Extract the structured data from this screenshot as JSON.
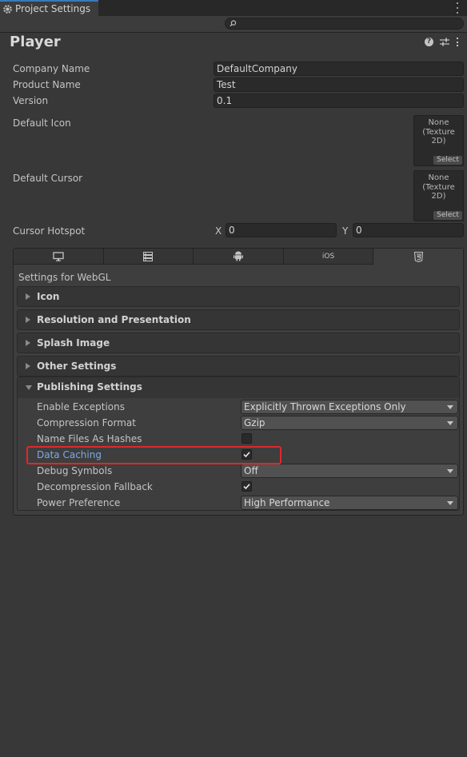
{
  "window": {
    "tab_title": "Project Settings",
    "tab_icon": "gear-icon"
  },
  "search": {
    "placeholder": ""
  },
  "header": {
    "title": "Player"
  },
  "fields": {
    "company_name": {
      "label": "Company Name",
      "value": "DefaultCompany"
    },
    "product_name": {
      "label": "Product Name",
      "value": "Test"
    },
    "version": {
      "label": "Version",
      "value": "0.1"
    },
    "default_icon": {
      "label": "Default Icon",
      "none_text": "None",
      "type_text": "(Texture 2D)",
      "select": "Select"
    },
    "default_cursor": {
      "label": "Default Cursor",
      "none_text": "None",
      "type_text": "(Texture 2D)",
      "select": "Select"
    },
    "cursor_hotspot": {
      "label": "Cursor Hotspot",
      "x_label": "X",
      "x_value": "0",
      "y_label": "Y",
      "y_value": "0"
    }
  },
  "platform_tabs": [
    {
      "icon": "monitor-icon"
    },
    {
      "icon": "server-icon"
    },
    {
      "icon": "android-icon"
    },
    {
      "label": "iOS"
    },
    {
      "icon": "html5-icon",
      "selected": true
    }
  ],
  "settings_for": "Settings for WebGL",
  "sections": [
    "Icon",
    "Resolution and Presentation",
    "Splash Image",
    "Other Settings"
  ],
  "publishing": {
    "title": "Publishing Settings",
    "rows": [
      {
        "label": "Enable Exceptions",
        "type": "dropdown",
        "value": "Explicitly Thrown Exceptions Only"
      },
      {
        "label": "Compression Format",
        "type": "dropdown",
        "value": "Gzip"
      },
      {
        "label": "Name Files As Hashes",
        "type": "checkbox",
        "checked": false
      },
      {
        "label": "Data Caching",
        "type": "checkbox",
        "checked": true,
        "highlighted": true
      },
      {
        "label": "Debug Symbols",
        "type": "dropdown",
        "value": "Off"
      },
      {
        "label": "Decompression Fallback",
        "type": "checkbox",
        "checked": true
      },
      {
        "label": "Power Preference",
        "type": "dropdown",
        "value": "High Performance"
      }
    ]
  },
  "colors": {
    "highlight_box": "#e0282c",
    "highlighted_label": "#7fa9e6",
    "accent_tab": "#3a79bb"
  }
}
